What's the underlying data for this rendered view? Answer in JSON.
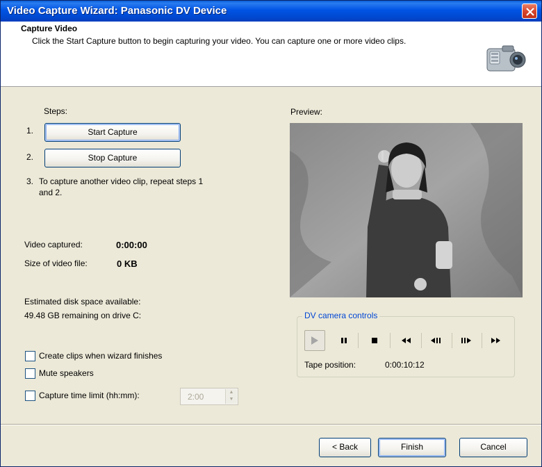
{
  "window": {
    "title": "Video Capture Wizard: Panasonic DV Device"
  },
  "header": {
    "title": "Capture Video",
    "description": "Click the Start Capture button to begin capturing your video. You can capture one or more video clips.",
    "icon": "camcorder-icon"
  },
  "steps": {
    "label": "Steps:",
    "items": [
      {
        "number": "1.",
        "button": "Start Capture"
      },
      {
        "number": "2.",
        "button": "Stop Capture"
      },
      {
        "number": "3.",
        "text": "To capture another video clip, repeat steps 1 and 2."
      }
    ]
  },
  "stats": {
    "video_captured_label": "Video captured:",
    "video_captured_value": "0:00:00",
    "file_size_label": "Size of video file:",
    "file_size_value": "0 KB",
    "disk_label": "Estimated disk space available:",
    "disk_value": "49.48 GB remaining on drive C:"
  },
  "options": {
    "create_clips": {
      "label": "Create clips when wizard finishes",
      "checked": false
    },
    "mute_speakers": {
      "label": "Mute speakers",
      "checked": false
    },
    "time_limit": {
      "label": "Capture time limit (hh:mm):",
      "checked": false,
      "value": "2:00",
      "enabled": false
    }
  },
  "preview": {
    "label": "Preview:"
  },
  "camera_controls": {
    "title": "DV camera controls",
    "buttons": [
      "play",
      "pause",
      "stop",
      "rewind",
      "step-back",
      "step-forward",
      "fast-forward"
    ],
    "tape_position_label": "Tape position:",
    "tape_position_value": "0:00:10:12"
  },
  "footer": {
    "back": "< Back",
    "finish": "Finish",
    "cancel": "Cancel"
  },
  "colors": {
    "titlebar": "#0054e3",
    "window_bg": "#ece9d8",
    "group_title": "#0046d5"
  }
}
